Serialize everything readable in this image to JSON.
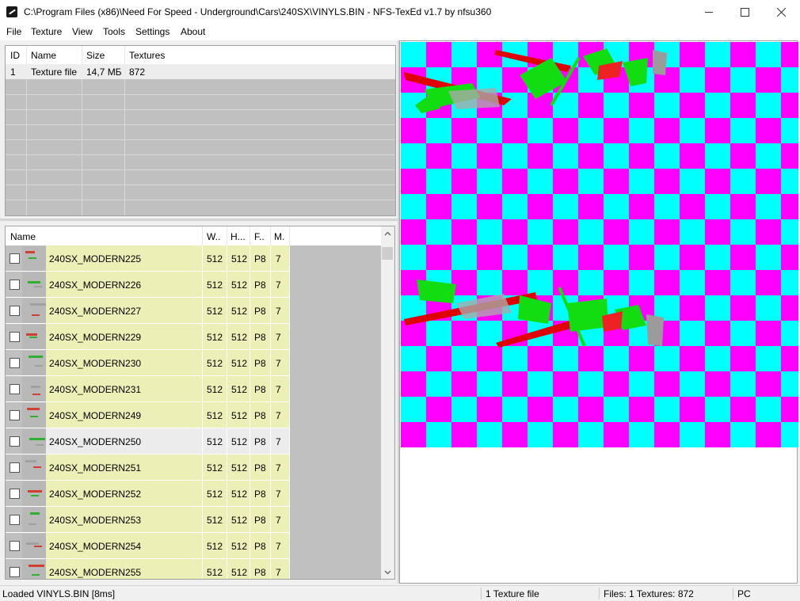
{
  "window": {
    "title": "C:\\Program Files (x86)\\Need For Speed - Underground\\Cars\\240SX\\VINYLS.BIN - NFS-TexEd v1.7 by nfsu360",
    "minimize_icon": "minimize-icon",
    "maximize_icon": "maximize-icon",
    "close_icon": "close-icon"
  },
  "menu": [
    "File",
    "Texture",
    "View",
    "Tools",
    "Settings",
    "About"
  ],
  "file_list": {
    "columns": [
      "ID",
      "Name",
      "Size",
      "Textures"
    ],
    "rows": [
      {
        "id": "1",
        "name": "Texture file",
        "size": "14,7 МБ",
        "textures": "872"
      }
    ]
  },
  "texture_list": {
    "columns": [
      "Name",
      "W..",
      "H...",
      "F..",
      "M."
    ],
    "selected_index": 7,
    "rows": [
      {
        "name": "240SX_MODERN225",
        "w": "512",
        "h": "512",
        "f": "P8",
        "m": "7"
      },
      {
        "name": "240SX_MODERN226",
        "w": "512",
        "h": "512",
        "f": "P8",
        "m": "7"
      },
      {
        "name": "240SX_MODERN227",
        "w": "512",
        "h": "512",
        "f": "P8",
        "m": "7"
      },
      {
        "name": "240SX_MODERN229",
        "w": "512",
        "h": "512",
        "f": "P8",
        "m": "7"
      },
      {
        "name": "240SX_MODERN230",
        "w": "512",
        "h": "512",
        "f": "P8",
        "m": "7"
      },
      {
        "name": "240SX_MODERN231",
        "w": "512",
        "h": "512",
        "f": "P8",
        "m": "7"
      },
      {
        "name": "240SX_MODERN249",
        "w": "512",
        "h": "512",
        "f": "P8",
        "m": "7"
      },
      {
        "name": "240SX_MODERN250",
        "w": "512",
        "h": "512",
        "f": "P8",
        "m": "7"
      },
      {
        "name": "240SX_MODERN251",
        "w": "512",
        "h": "512",
        "f": "P8",
        "m": "7"
      },
      {
        "name": "240SX_MODERN252",
        "w": "512",
        "h": "512",
        "f": "P8",
        "m": "7"
      },
      {
        "name": "240SX_MODERN253",
        "w": "512",
        "h": "512",
        "f": "P8",
        "m": "7"
      },
      {
        "name": "240SX_MODERN254",
        "w": "512",
        "h": "512",
        "f": "P8",
        "m": "7"
      },
      {
        "name": "240SX_MODERN255",
        "w": "512",
        "h": "512",
        "f": "P8",
        "m": "7"
      }
    ]
  },
  "status": {
    "message": "Loaded VINYLS.BIN [8ms]",
    "file_count": "1 Texture file",
    "summary": "Files: 1 Textures: 872",
    "platform": "PC"
  },
  "colors": {
    "checker_a": "#00ffff",
    "checker_b": "#ff00ff",
    "row_highlight": "#ecefb6",
    "list_bg": "#c0c0c0"
  }
}
